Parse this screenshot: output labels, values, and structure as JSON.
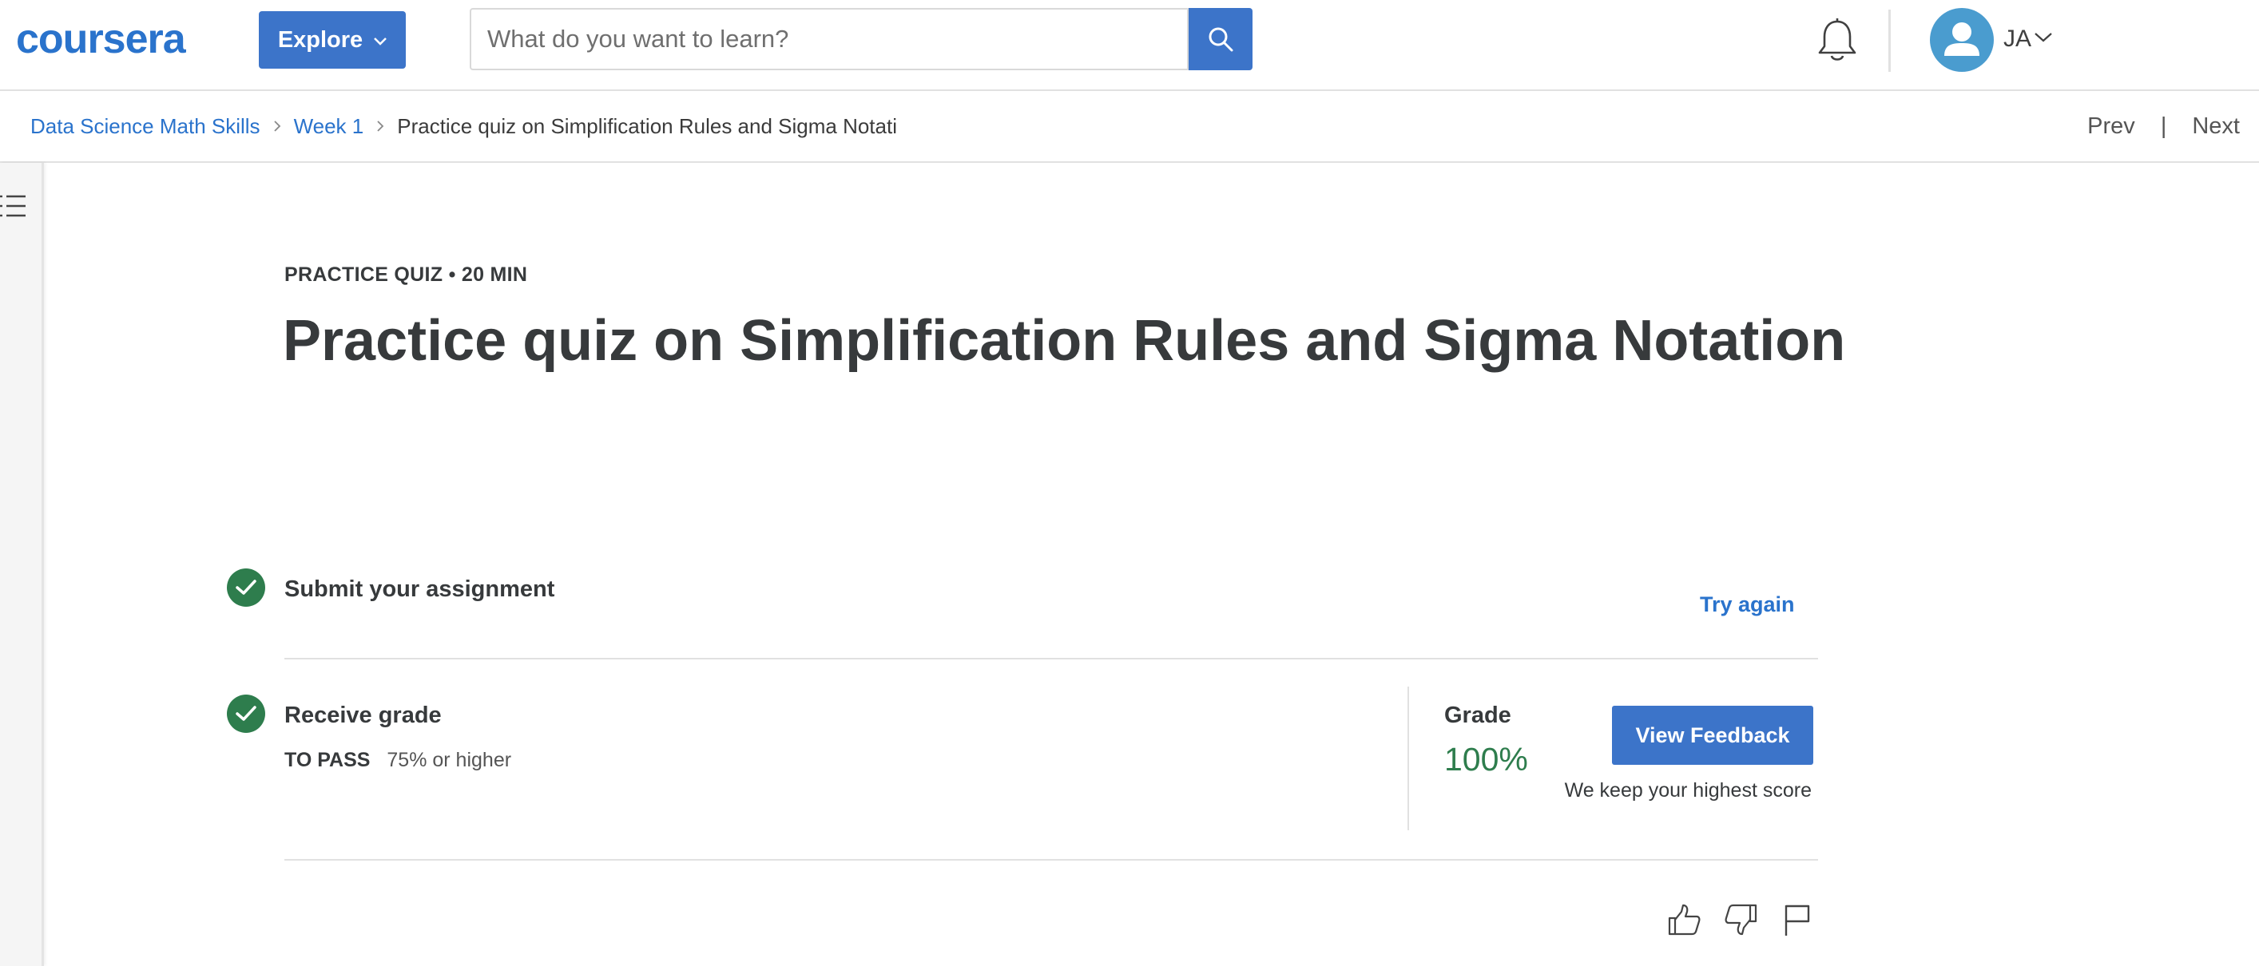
{
  "header": {
    "logo_text": "coursera",
    "explore_label": "Explore",
    "search": {
      "placeholder": "What do you want to learn?"
    },
    "user_initials": "JA"
  },
  "breadcrumb": {
    "items": [
      "Data Science Math Skills",
      "Week 1"
    ],
    "current": "Practice quiz on Simplification Rules and Sigma Notati"
  },
  "nav": {
    "prev": "Prev",
    "separator": "|",
    "next": "Next"
  },
  "quiz": {
    "kicker": "PRACTICE QUIZ • 20 MIN",
    "title": "Practice quiz on Simplification Rules and Sigma Notation"
  },
  "steps": {
    "submit": {
      "title": "Submit your assignment",
      "action": "Try again"
    },
    "grade": {
      "title": "Receive grade",
      "pass_label": "TO PASS",
      "pass_value": "75% or higher",
      "grade_label": "Grade",
      "grade_value": "100%",
      "feedback_button": "View Feedback",
      "note": "We keep your highest score"
    }
  },
  "colors": {
    "brand_blue": "#3c74c9",
    "link_blue": "#2a73cc",
    "success_green": "#2e7d4d",
    "avatar_blue": "#4a9ccf"
  },
  "icons": [
    "search-icon",
    "bell-icon",
    "user-icon",
    "chevron-down-icon",
    "chevron-right-icon",
    "list-menu-icon",
    "check-icon",
    "thumbs-up-icon",
    "thumbs-down-icon",
    "flag-icon"
  ]
}
